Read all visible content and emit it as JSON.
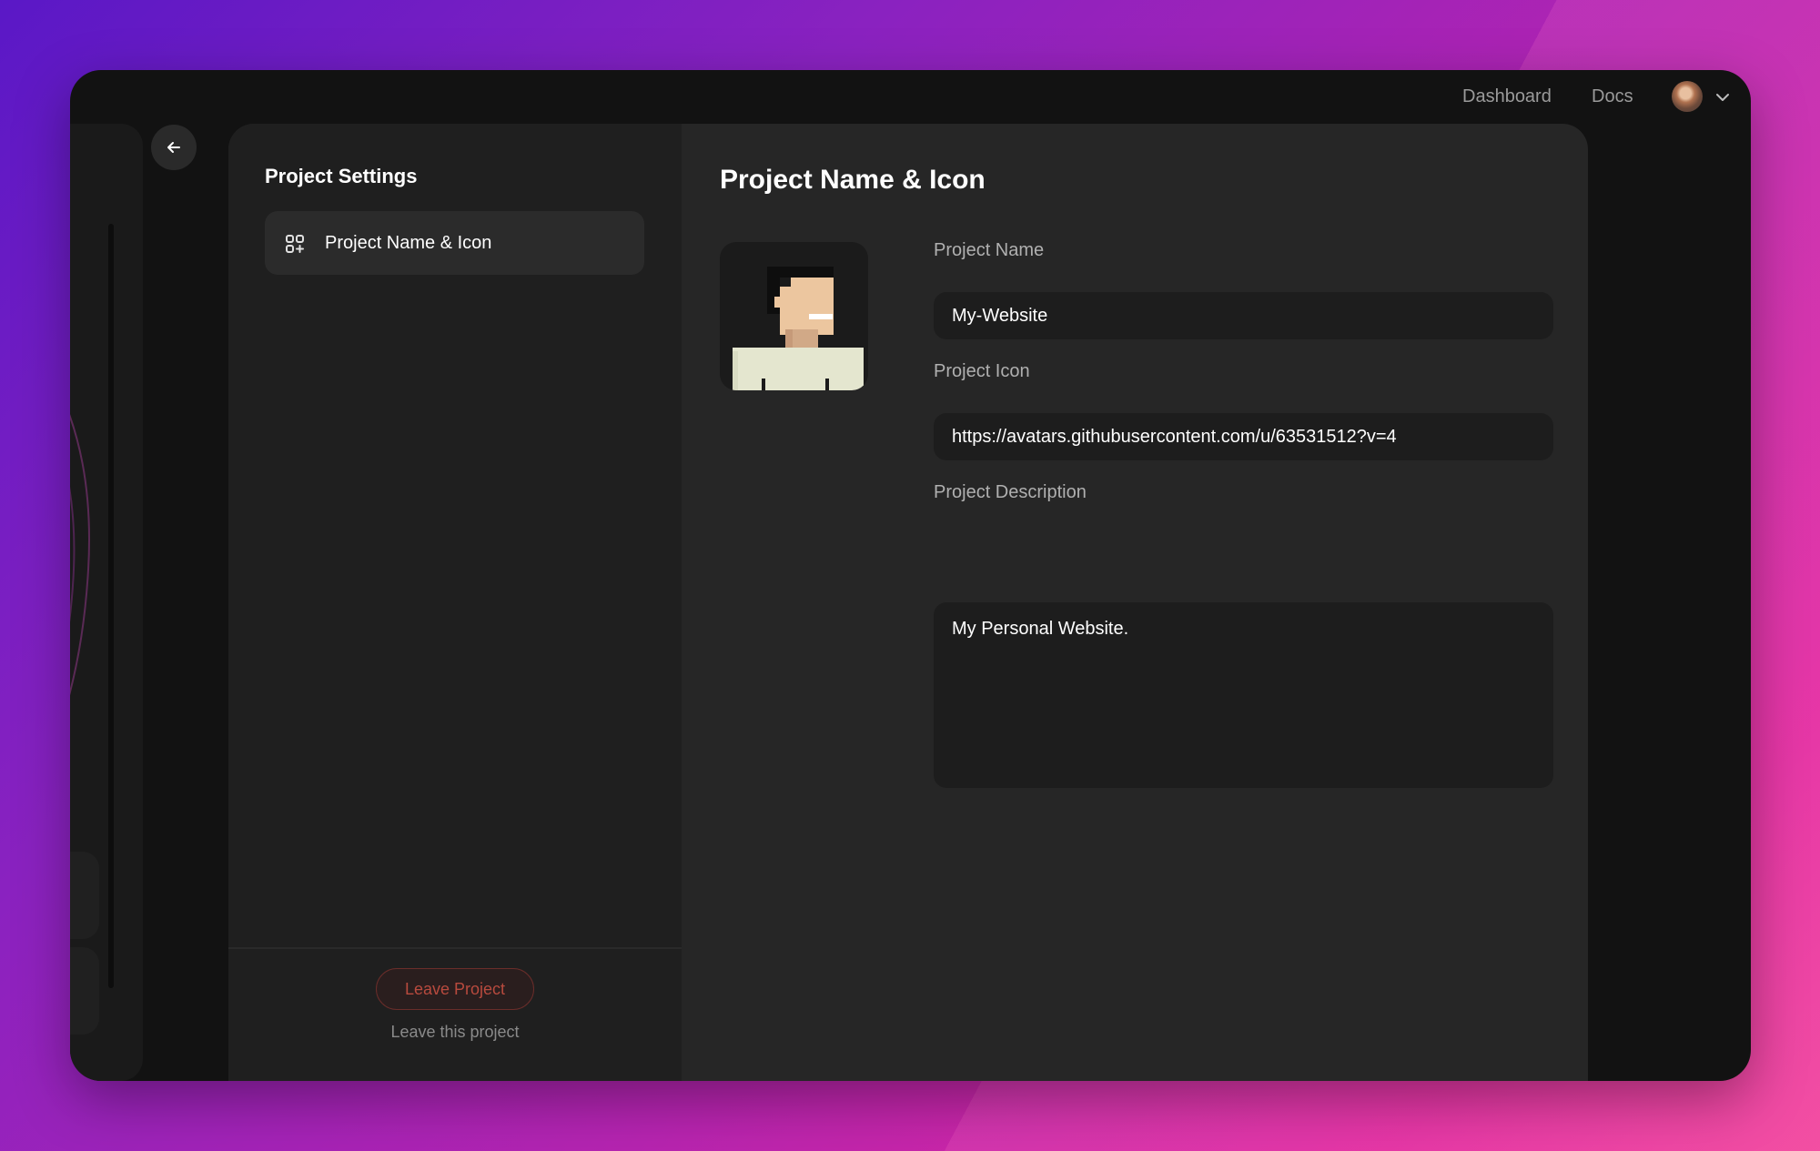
{
  "nav": {
    "dashboard_label": "Dashboard",
    "docs_label": "Docs",
    "avatar_icon": "user-avatar-icon",
    "menu_icon": "chevron-down-icon"
  },
  "back_icon": "arrow-left-icon",
  "sidebar": {
    "title": "Project Settings",
    "items": [
      {
        "label": "Project Name & Icon",
        "icon": "apps-add-icon",
        "active": true
      }
    ],
    "leave_button_label": "Leave Project",
    "leave_caption": "Leave this project"
  },
  "main": {
    "title": "Project Name & Icon",
    "icon_image": "pixel-avatar-image",
    "fields": {
      "name": {
        "label": "Project Name",
        "value": "My-Website"
      },
      "icon": {
        "label": "Project Icon",
        "value": "https://avatars.githubusercontent.com/u/63531512?v=4"
      },
      "description": {
        "label": "Project Description",
        "value": "My Personal Website."
      }
    }
  },
  "colors": {
    "window_bg": "#121212",
    "modal_bg": "#262626",
    "sidebar_bg": "#1f1f1f",
    "danger": "#b84a3e"
  }
}
